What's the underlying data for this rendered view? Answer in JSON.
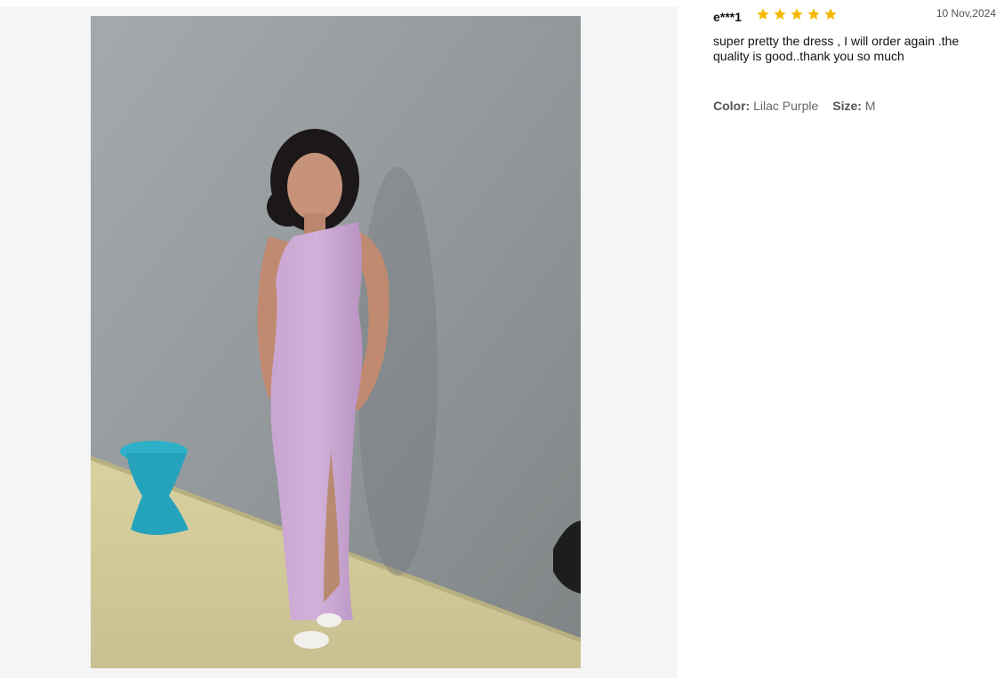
{
  "review": {
    "reviewer": "e***1",
    "rating": 5,
    "date": "10 Nov,2024",
    "text": "super pretty the dress , I will order again .the quality is good..thank you so much",
    "color_label": "Color:",
    "color_value": "Lilac Purple",
    "size_label": "Size:",
    "size_value": "M"
  },
  "icons": {
    "star": "star-icon"
  },
  "colors": {
    "star": "#f5b800",
    "dress": "#c9a8d4"
  }
}
